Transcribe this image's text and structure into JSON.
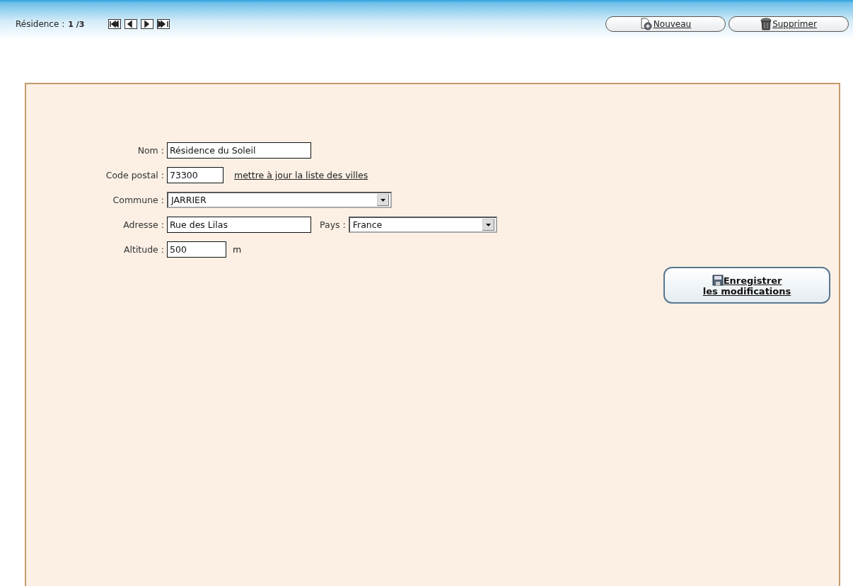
{
  "header": {
    "label": "Résidence :",
    "position": "1 /3",
    "nav": [
      {
        "kind": "first"
      },
      {
        "kind": "prev"
      },
      {
        "kind": "next"
      },
      {
        "kind": "last"
      }
    ],
    "buttons": [
      {
        "label": "Nouveau",
        "kind": "new"
      },
      {
        "label": "Supprimer",
        "kind": "delete"
      }
    ]
  },
  "form": {
    "rows": [
      {
        "fields": [
          {
            "label": "Nom :",
            "kind": "text",
            "value": "Résidence du Soleil"
          }
        ]
      },
      {
        "fields": [
          {
            "label": "Code postal :",
            "kind": "text",
            "value": "73300"
          }
        ],
        "link": "mettre à jour la liste des villes"
      },
      {
        "fields": [
          {
            "label": "Commune :",
            "kind": "select",
            "value": "JARRIER"
          }
        ]
      },
      {
        "fields": [
          {
            "label": "Adresse :",
            "kind": "text",
            "value": "Rue des Lilas"
          },
          {
            "label": "Pays :",
            "kind": "select",
            "value": "France"
          }
        ]
      },
      {
        "fields": [
          {
            "label": "Altitude :",
            "kind": "text",
            "value": "500"
          }
        ],
        "unit": "m"
      }
    ],
    "save_button": [
      "Enregistrer",
      "les modifications"
    ]
  }
}
